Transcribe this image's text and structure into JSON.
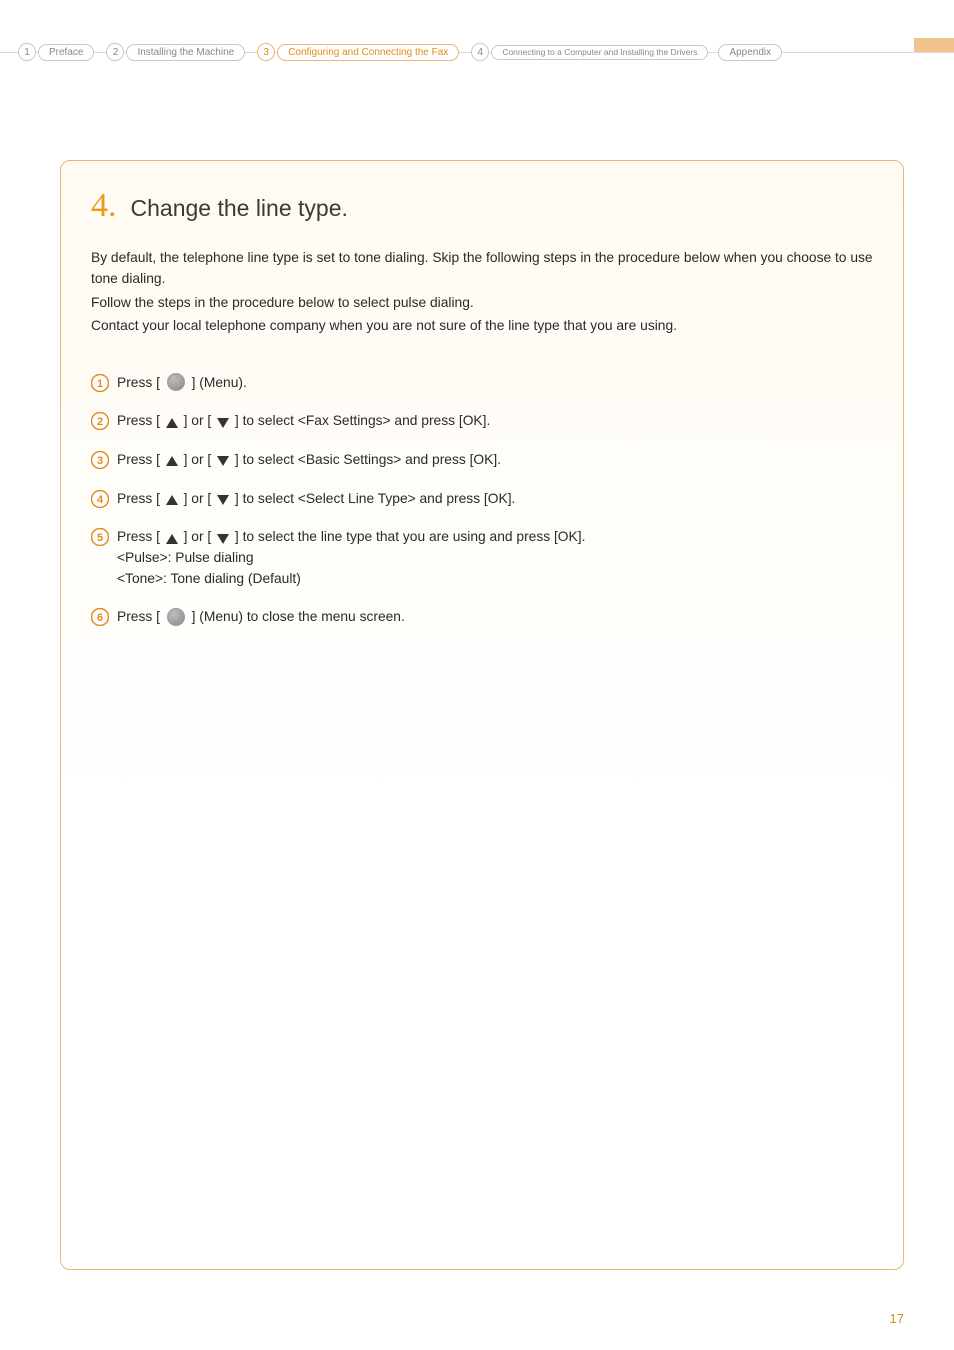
{
  "breadcrumb": {
    "items": [
      {
        "num": "1",
        "label": "Preface",
        "active": false
      },
      {
        "num": "2",
        "label": "Installing the Machine",
        "active": false
      },
      {
        "num": "3",
        "label": "Configuring and Connecting the Fax",
        "active": true
      },
      {
        "num": "4",
        "label": "Connecting to a Computer and Installing the Drivers",
        "active": false
      },
      {
        "num": "",
        "label": "Appendix",
        "active": false
      }
    ]
  },
  "section": {
    "number": "4.",
    "heading": "Change the line type."
  },
  "intro": {
    "p1": "By default, the telephone line type is set to tone dialing. Skip the following steps in the procedure below when you choose to use tone dialing.",
    "p2": "Follow the steps in the procedure below to select pulse dialing.",
    "p3": "Contact your local telephone company when you are not sure of the line type that you are using."
  },
  "steps": [
    {
      "num": "1",
      "parts": {
        "a": "Press [",
        "b": "] (Menu)."
      },
      "has_menu_icon": true
    },
    {
      "num": "2",
      "parts": {
        "a": "Press [",
        "b": "] or [",
        "c": "] to select <Fax Settings> and press [OK]."
      },
      "has_arrows": true
    },
    {
      "num": "3",
      "parts": {
        "a": "Press [",
        "b": "] or [",
        "c": "] to select <Basic Settings> and press [OK]."
      },
      "has_arrows": true
    },
    {
      "num": "4",
      "parts": {
        "a": "Press [",
        "b": "] or [",
        "c": "] to select <Select Line Type> and press [OK]."
      },
      "has_arrows": true
    },
    {
      "num": "5",
      "parts": {
        "a": "Press [",
        "b": "] or [",
        "c": "] to select the line type that you are using and press [OK]."
      },
      "has_arrows": true,
      "sub": [
        "<Pulse>: Pulse dialing",
        "<Tone>: Tone dialing (Default)"
      ]
    },
    {
      "num": "6",
      "parts": {
        "a": "Press [",
        "b": "] (Menu) to close the menu screen."
      },
      "has_menu_icon": true
    }
  ],
  "page_number": "17"
}
